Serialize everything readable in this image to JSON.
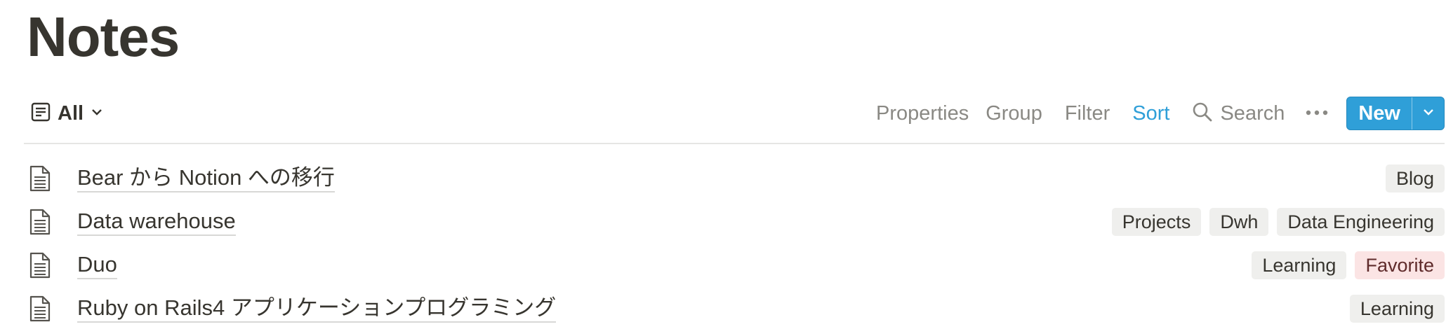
{
  "page": {
    "title": "Notes"
  },
  "toolbar": {
    "view_label": "All",
    "properties_label": "Properties",
    "group_label": "Group",
    "filter_label": "Filter",
    "sort_label": "Sort",
    "search_label": "Search",
    "new_label": "New",
    "accent_color": "#2f9fd8"
  },
  "rows": [
    {
      "title": "Bear から Notion への移行",
      "icon": "document-icon",
      "tags": [
        "Blog"
      ]
    },
    {
      "title": "Data warehouse",
      "icon": "document-icon",
      "tags": [
        "Projects",
        "Dwh",
        "Data Engineering"
      ]
    },
    {
      "title": "Duo",
      "icon": "document-icon",
      "tags": [
        "Learning",
        "Favorite"
      ]
    },
    {
      "title": "Ruby on Rails4 アプリケーションプログラミング",
      "icon": "document-icon",
      "tags": [
        "Learning"
      ]
    }
  ],
  "tag_colors": {
    "default": "#efefed",
    "Favorite": "#fbe4e4"
  }
}
